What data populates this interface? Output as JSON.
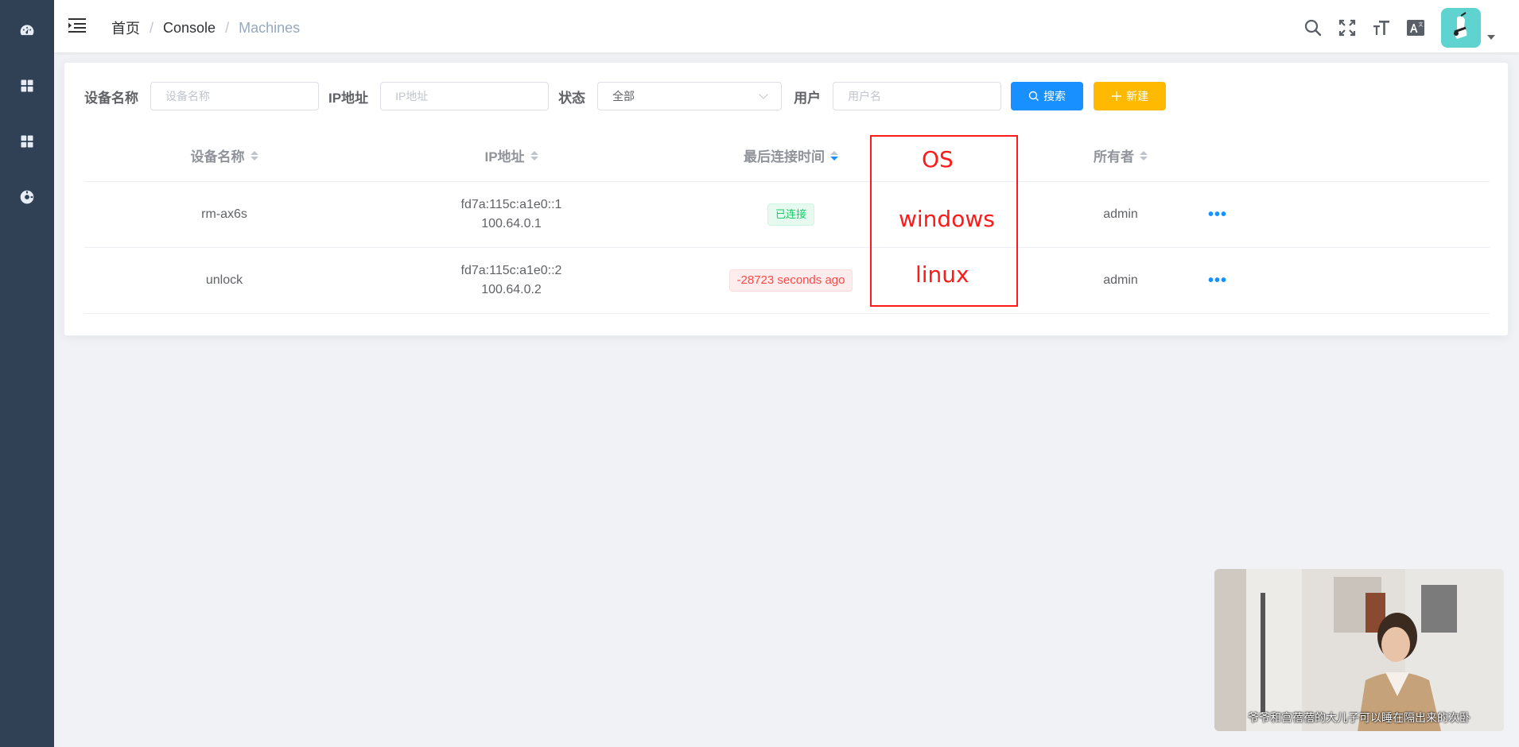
{
  "sidebar": {
    "items": [
      {
        "icon": "dashboard-icon"
      },
      {
        "icon": "grid-icon"
      },
      {
        "icon": "grid-icon"
      },
      {
        "icon": "settings-icon"
      }
    ]
  },
  "header": {
    "breadcrumb": [
      "首页",
      "Console",
      "Machines"
    ],
    "icons": [
      "search-icon",
      "fullscreen-icon",
      "font-size-icon",
      "translate-icon"
    ],
    "avatar": "avatar"
  },
  "search": {
    "device_label": "设备名称",
    "device_placeholder": "设备名称",
    "ip_label": "IP地址",
    "ip_placeholder": "IP地址",
    "status_label": "状态",
    "status_value": "全部",
    "user_label": "用户",
    "user_placeholder": "用户名",
    "search_button": "搜索",
    "new_button": "新建"
  },
  "table": {
    "headers": {
      "name": "设备名称",
      "ip": "IP地址",
      "last_seen": "最后连接时间",
      "owner": "所有者"
    },
    "rows": [
      {
        "name": "rm-ax6s",
        "ip1": "fd7a:115c:a1e0::1",
        "ip2": "100.64.0.1",
        "status": "已连接",
        "owner": "admin",
        "more": "•••"
      },
      {
        "name": "unlock",
        "ip1": "fd7a:115c:a1e0::2",
        "ip2": "100.64.0.2",
        "status": "-28723 seconds ago",
        "owner": "admin",
        "more": "•••"
      }
    ]
  },
  "annotation": {
    "header": "OS",
    "row1": "windows",
    "row2": "linux",
    "color": "#ff1a1a"
  },
  "video": {
    "subtitle": "爷爷和宫蓓蓓的大儿子可以睡在隔出来的次卧"
  },
  "colors": {
    "sidebar": "#304156",
    "primary": "#1890ff",
    "warning": "#ffba00",
    "success": "#13ce66",
    "danger": "#ff4949"
  }
}
